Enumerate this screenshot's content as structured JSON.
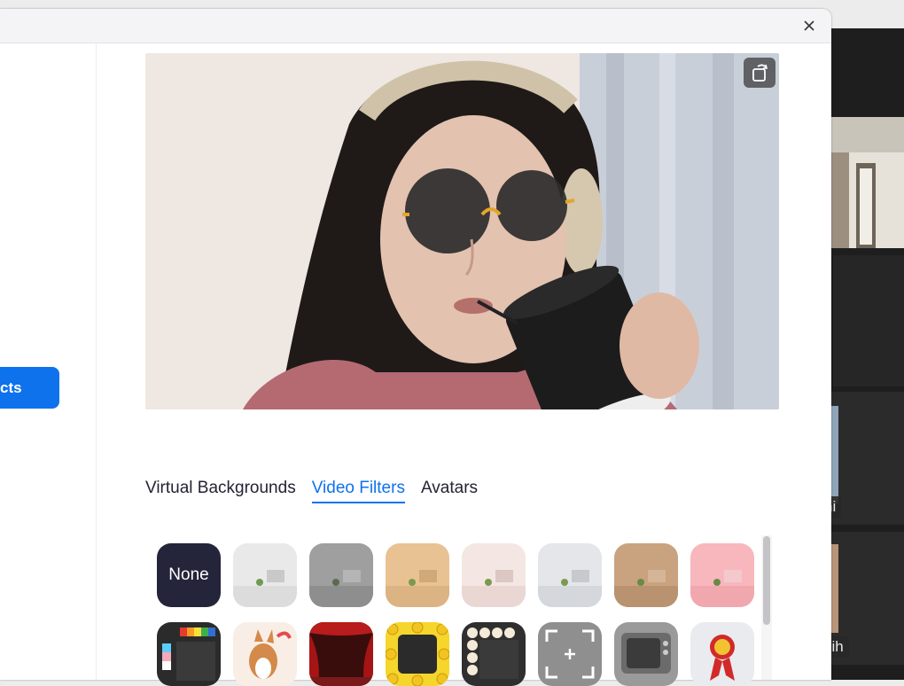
{
  "sidebar": {
    "active_item_label": "cts"
  },
  "tabs": [
    {
      "label": "Virtual Backgrounds"
    },
    {
      "label": "Video Filters"
    },
    {
      "label": "Avatars"
    }
  ],
  "active_tab": "Video Filters",
  "filters": {
    "none_label": "None",
    "row1": [
      "none",
      "white-room-filter",
      "gray-room-filter",
      "beige-room-filter",
      "blush-room-filter",
      "light-gray-room-filter",
      "tan-room-filter",
      "pink-room-filter"
    ],
    "row2": [
      "pride-frame-filter",
      "corgi-filter",
      "theater-curtain-filter",
      "emoji-frame-filter",
      "bulb-frame-filter",
      "camera-focus-filter",
      "retro-tv-filter",
      "ribbon-award-filter"
    ]
  },
  "background_meeting": {
    "participant_names": [
      "ni",
      "sih"
    ]
  },
  "colors": {
    "accent": "#0e72ed",
    "tab_text": "#232333",
    "none_thumb_bg": "#24243a"
  }
}
